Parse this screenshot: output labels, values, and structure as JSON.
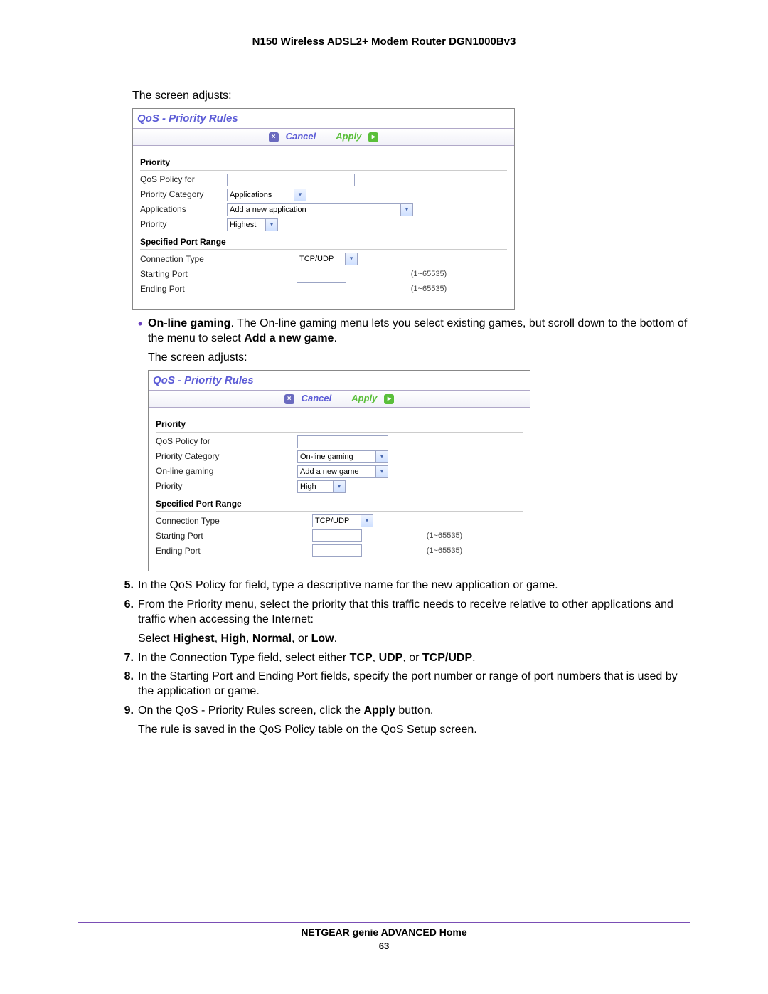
{
  "header": "N150 Wireless ADSL2+ Modem Router DGN1000Bv3",
  "lead1": "The screen adjusts:",
  "panel1": {
    "title": "QoS - Priority Rules",
    "toolbar": {
      "cancel": "Cancel",
      "apply": "Apply"
    },
    "section1": "Priority",
    "labels": {
      "policy": "QoS Policy for",
      "category": "Priority Category",
      "sub": "Applications",
      "prio": "Priority"
    },
    "values": {
      "category": "Applications",
      "sub": "Add a new application",
      "prio": "Highest"
    },
    "section2": "Specified Port Range",
    "port": {
      "conn_label": "Connection Type",
      "conn_val": "TCP/UDP",
      "start_label": "Starting Port",
      "end_label": "Ending Port",
      "hint": "(1~65535)"
    }
  },
  "bullet": {
    "lead_bold": "On-line gaming",
    "text": ". The On-line gaming menu lets you select existing games, but scroll down to the bottom of the menu to select ",
    "bold_tail": "Add a new game",
    "tail": "."
  },
  "lead2": "The screen adjusts:",
  "panel2": {
    "title": "QoS - Priority Rules",
    "toolbar": {
      "cancel": "Cancel",
      "apply": "Apply"
    },
    "section1": "Priority",
    "labels": {
      "policy": "QoS Policy for",
      "category": "Priority Category",
      "sub": "On-line gaming",
      "prio": "Priority"
    },
    "values": {
      "category": "On-line gaming",
      "sub": "Add a new game",
      "prio": "High"
    },
    "section2": "Specified Port Range",
    "port": {
      "conn_label": "Connection Type",
      "conn_val": "TCP/UDP",
      "start_label": "Starting Port",
      "end_label": "Ending Port",
      "hint": "(1~65535)"
    }
  },
  "steps": {
    "s5": {
      "n": "5.",
      "t": "In the QoS Policy for field, type a descriptive name for the new application or game."
    },
    "s6": {
      "n": "6.",
      "t": "From the Priority menu, select the priority that this traffic needs to receive relative to other applications and traffic when accessing the Internet:"
    },
    "s6b": {
      "pre": "Select ",
      "b1": "Highest",
      "c1": ", ",
      "b2": "High",
      "c2": ", ",
      "b3": "Normal",
      "c3": ", or ",
      "b4": "Low",
      "post": "."
    },
    "s7": {
      "n": "7.",
      "pre": "In the Connection Type field, select either ",
      "b1": "TCP",
      "c1": ", ",
      "b2": "UDP",
      "c2": ", or ",
      "b3": "TCP/UDP",
      "post": "."
    },
    "s8": {
      "n": "8.",
      "t": "In the Starting Port and Ending Port fields, specify the port number or range of port numbers that is used by the application or game."
    },
    "s9": {
      "n": "9.",
      "pre": "On the QoS - Priority Rules screen, click the ",
      "b1": "Apply",
      "post": " button."
    },
    "s9b": "The rule is saved in the QoS Policy table on the QoS Setup screen."
  },
  "footer": {
    "title": "NETGEAR genie ADVANCED Home",
    "page": "63"
  }
}
